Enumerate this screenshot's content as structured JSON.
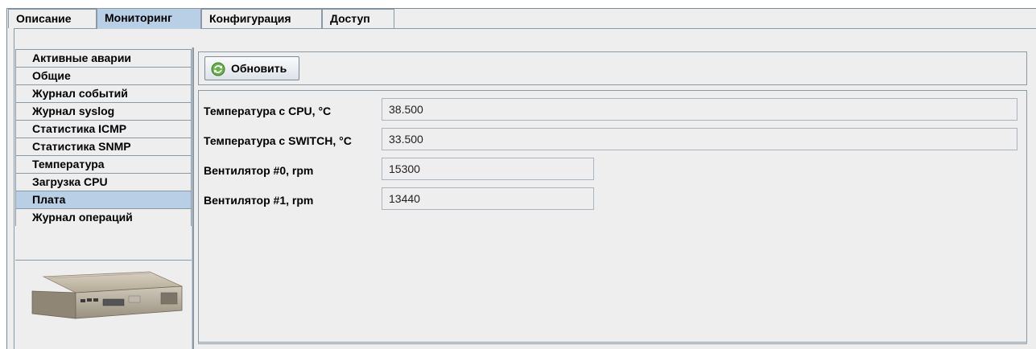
{
  "top_tabs": [
    {
      "label": "Описание",
      "active": false
    },
    {
      "label": "Мониторинг",
      "active": true
    },
    {
      "label": "Конфигурация",
      "active": false
    },
    {
      "label": "Доступ",
      "active": false
    }
  ],
  "sidebar": {
    "items": [
      {
        "label": "Активные аварии",
        "active": false
      },
      {
        "label": "Общие",
        "active": false
      },
      {
        "label": "Журнал событий",
        "active": false
      },
      {
        "label": "Журнал syslog",
        "active": false
      },
      {
        "label": "Статистика ICMP",
        "active": false
      },
      {
        "label": "Статистика SNMP",
        "active": false
      },
      {
        "label": "Температура",
        "active": false
      },
      {
        "label": "Загрузка CPU",
        "active": false
      },
      {
        "label": "Плата",
        "active": true
      },
      {
        "label": "Журнал операций",
        "active": false
      }
    ]
  },
  "toolbar": {
    "refresh_label": "Обновить",
    "refresh_icon": "refresh-icon"
  },
  "fields": [
    {
      "label": "Температура с CPU, °C",
      "value": "38.500"
    },
    {
      "label": "Температура с SWITCH, °C",
      "value": "33.500"
    },
    {
      "label": "Вентилятор #0, rpm",
      "value": "15300"
    },
    {
      "label": "Вентилятор #1, rpm",
      "value": "13440"
    }
  ],
  "colors": {
    "active_tab": "#b8cfe5",
    "panel_bg": "#eeeeee",
    "border": "#8a99a6"
  }
}
